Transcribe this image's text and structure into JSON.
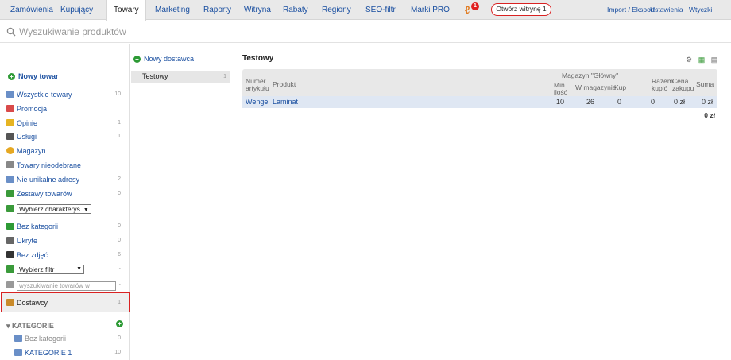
{
  "nav": {
    "items": [
      "Zamówienia",
      "Kupujący",
      "Towary",
      "Marketing",
      "Raporty",
      "Witryna",
      "Rabaty",
      "Regiony",
      "SEO-filtr",
      "Marki PRO"
    ],
    "active": "Towary",
    "notification_count": "1",
    "open_shop_label": "Otwórz witrynę 1",
    "right_links": [
      "Import / Eksport",
      "Ustawienia",
      "Wtyczki"
    ]
  },
  "search": {
    "placeholder": "Wyszukiwanie produktów"
  },
  "sidebar": {
    "new_product_label": "Nowy towar",
    "items": [
      {
        "label": "Wszystkie towary",
        "count": "10",
        "icon": "box-icon",
        "color": "#6a8fc7"
      },
      {
        "label": "Promocja",
        "count": "",
        "icon": "promo-icon",
        "color": "#d94a4a"
      },
      {
        "label": "Opinie",
        "count": "1",
        "icon": "pencil-icon",
        "color": "#e6b422"
      },
      {
        "label": "Usługi",
        "count": "1",
        "icon": "services-icon",
        "color": "#555555"
      },
      {
        "label": "Magazyn",
        "count": "",
        "icon": "warehouse-icon",
        "color": "#e6a822"
      },
      {
        "label": "Towary nieodebrane",
        "count": "",
        "icon": "funnel-icon",
        "color": "#888888"
      },
      {
        "label": "Nie unikalne adresy",
        "count": "2",
        "icon": "doc-icon",
        "color": "#6a8fc7"
      },
      {
        "label": "Zestawy towarów",
        "count": "0",
        "icon": "set-icon",
        "color": "#3a9a3a"
      }
    ],
    "characteristic_select": "Wybierz charakterys",
    "items2": [
      {
        "label": "Bez kategorii",
        "count": "0",
        "icon": "check-icon",
        "color": "#2d9a35"
      },
      {
        "label": "Ukryte",
        "count": "0",
        "icon": "eye-slash-icon",
        "color": "#666666"
      },
      {
        "label": "Bez zdjęć",
        "count": "6",
        "icon": "image-icon",
        "color": "#333333"
      }
    ],
    "filter_select": "Wybierz filtr",
    "search_placeholder": "wyszukiwanie towarów w",
    "dostawcy_label": "Dostawcy",
    "dostawcy_count": "1",
    "categories_label": "KATEGORIE",
    "categories": [
      {
        "label": "Bez kategorii",
        "count": "0",
        "color": "#6a8fc7"
      },
      {
        "label": "KATEGORIE 1",
        "count": "10",
        "color": "#6a8fc7"
      }
    ]
  },
  "suppliers": {
    "new_supplier_label": "Nowy dostawca",
    "items": [
      {
        "label": "Testowy",
        "count": "1"
      }
    ]
  },
  "main": {
    "title": "Testowy",
    "table": {
      "col_article": [
        "Numer",
        "artykułu"
      ],
      "col_product": "Produkt",
      "group_header": "Magazyn \"Główny\"",
      "col_min": [
        "Min.",
        "ilość"
      ],
      "col_stock": "W magazynie",
      "col_buy": "Kup",
      "col_total_buy": [
        "Razem",
        "kupić"
      ],
      "col_price": [
        "Cena",
        "zakupu"
      ],
      "col_sum": "Suma",
      "rows": [
        {
          "article": "Wenge",
          "product": "Laminat",
          "min": "10",
          "stock": "26",
          "buy": "0",
          "total_buy": "0",
          "price": "0 zł",
          "sum": "0 zł"
        }
      ],
      "total": "0 zł"
    }
  }
}
